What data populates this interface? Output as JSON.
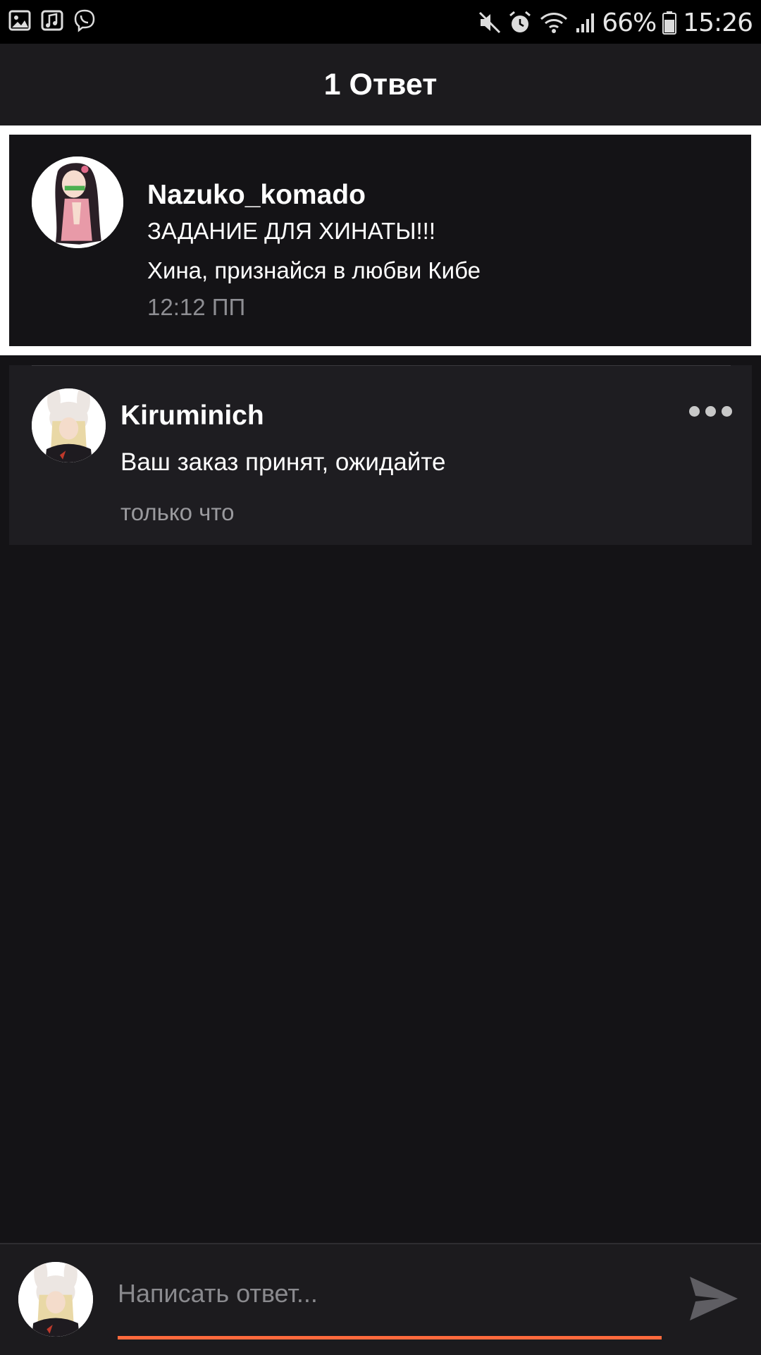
{
  "status_bar": {
    "icons_left": [
      "gallery-icon",
      "music-icon",
      "viber-icon"
    ],
    "icons_right": [
      "mute-icon",
      "alarm-icon",
      "wifi-icon",
      "signal-icon",
      "battery-icon"
    ],
    "battery": "66%",
    "time": "15:26"
  },
  "header": {
    "title": "1 Ответ"
  },
  "parent_comment": {
    "username": "Nazuko_komado",
    "line1": "ЗАДАНИЕ ДЛЯ ХИНАТЫ!!!",
    "line2": "Хина, признайся в любви Кибе",
    "time": "12:12 ПП"
  },
  "reply": {
    "username": "Kiruminich",
    "text": "Ваш заказ принят, ожидайте",
    "time": "только что",
    "more_icon": "more-dots-icon"
  },
  "composer": {
    "placeholder": "Написать ответ...",
    "send_icon": "send-icon"
  },
  "colors": {
    "background": "#141316",
    "header_bg": "#1c1b1e",
    "card_bg": "#1e1d21",
    "accent": "#ff6a3d",
    "muted_text": "#8e8e93"
  }
}
